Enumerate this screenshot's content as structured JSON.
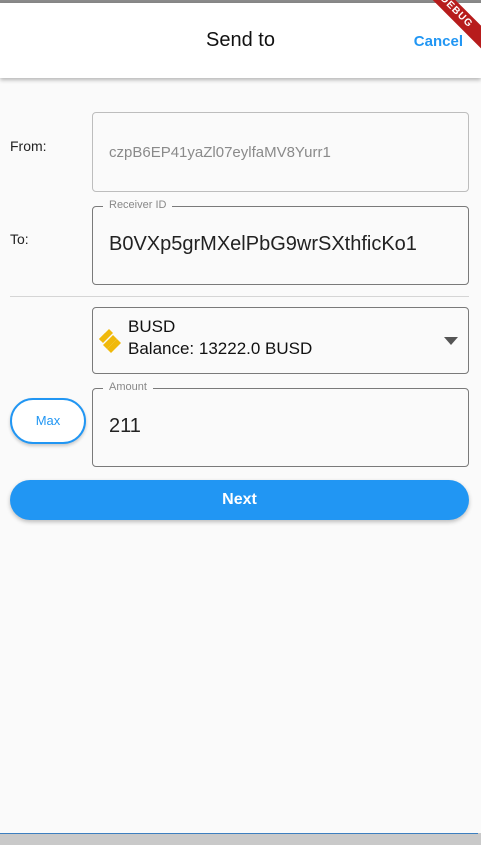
{
  "appbar": {
    "title": "Send to",
    "cancel_label": "Cancel",
    "debug_banner": "DEBUG"
  },
  "form": {
    "from_label": "From:",
    "from_value": "czpB6EP41yaZl07eylfaMV8Yurr1",
    "to_label": "To:",
    "receiver_float_label": "Receiver ID",
    "receiver_value": "B0VXp5grMXelPbG9wrSXthficKo1",
    "token": {
      "name": "BUSD",
      "balance": "Balance: 13222.0 BUSD",
      "icon": "binance-busd-icon",
      "icon_color": "#f0b90b"
    },
    "amount_float_label": "Amount",
    "amount_value": "211",
    "max_label": "Max",
    "next_label": "Next"
  },
  "colors": {
    "accent": "#2196f3"
  }
}
